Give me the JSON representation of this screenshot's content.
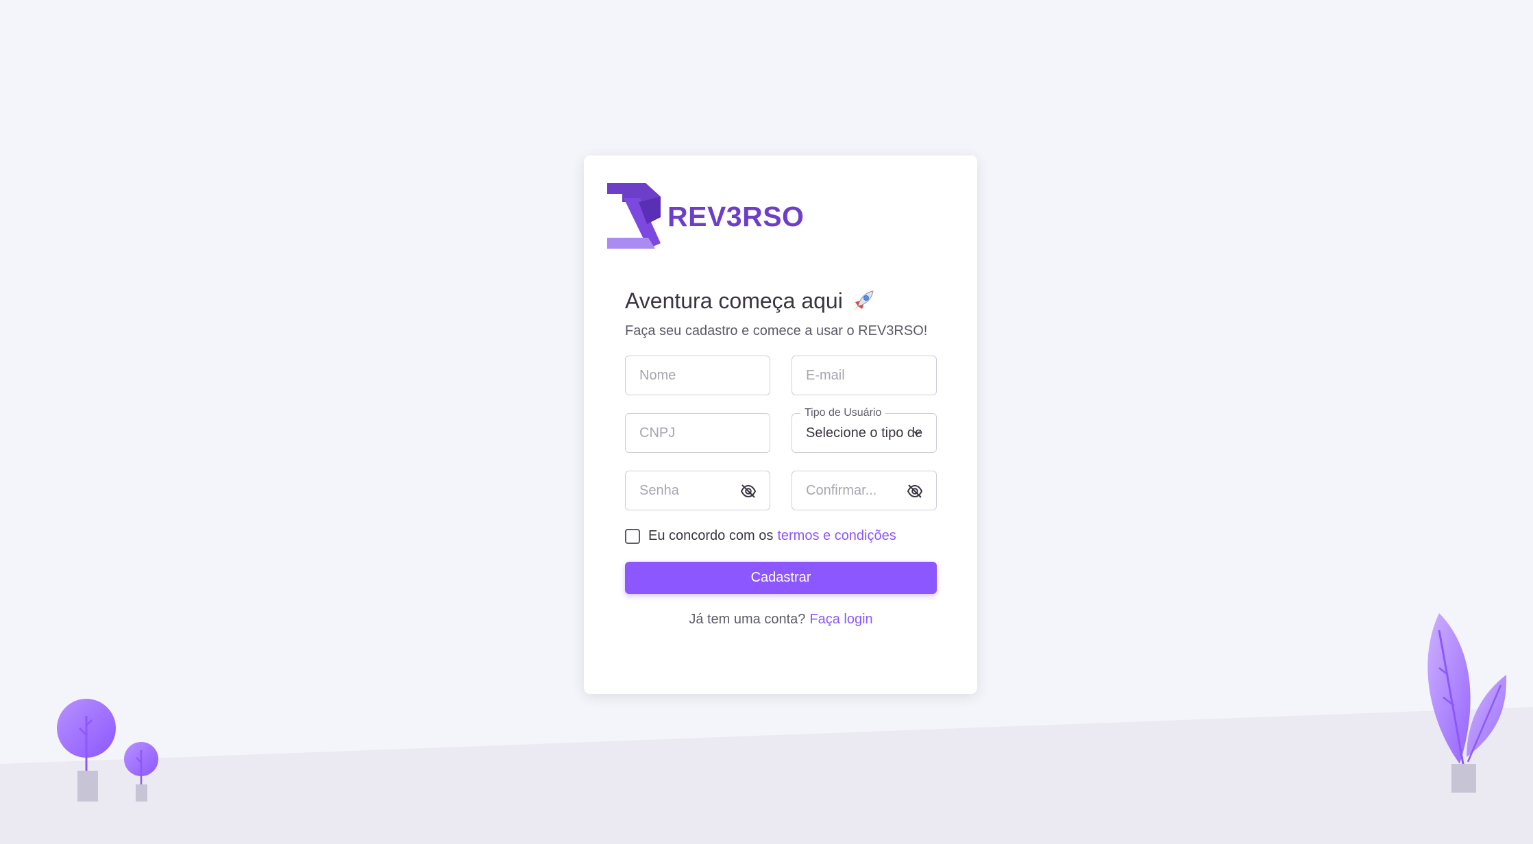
{
  "brand": {
    "name": "REV3RSO"
  },
  "heading": {
    "title": "Aventura começa aqui",
    "subtitle": "Faça seu cadastro e comece a usar o REV3RSO!"
  },
  "form": {
    "name_placeholder": "Nome",
    "email_placeholder": "E-mail",
    "cnpj_placeholder": "CNPJ",
    "user_type_label": "Tipo de Usuário",
    "user_type_value": "Selecione o tipo de",
    "password_placeholder": "Senha",
    "confirm_placeholder": "Confirmar..."
  },
  "terms": {
    "text": "Eu concordo com os",
    "link": "termos e condições"
  },
  "submit_label": "Cadastrar",
  "login": {
    "text": "Já tem uma conta?",
    "link": "Faça login"
  },
  "icons": {
    "logo": "rev3rso-logo-icon",
    "rocket": "rocket-icon",
    "password_eye": "eye-off-icon",
    "confirm_eye": "eye-off-icon",
    "select_caret": "chevron-down-icon"
  },
  "colors": {
    "primary": "#8c57ff",
    "brand": "#6d3fc9",
    "text": "#3a3541",
    "background": "#f4f5fa"
  }
}
